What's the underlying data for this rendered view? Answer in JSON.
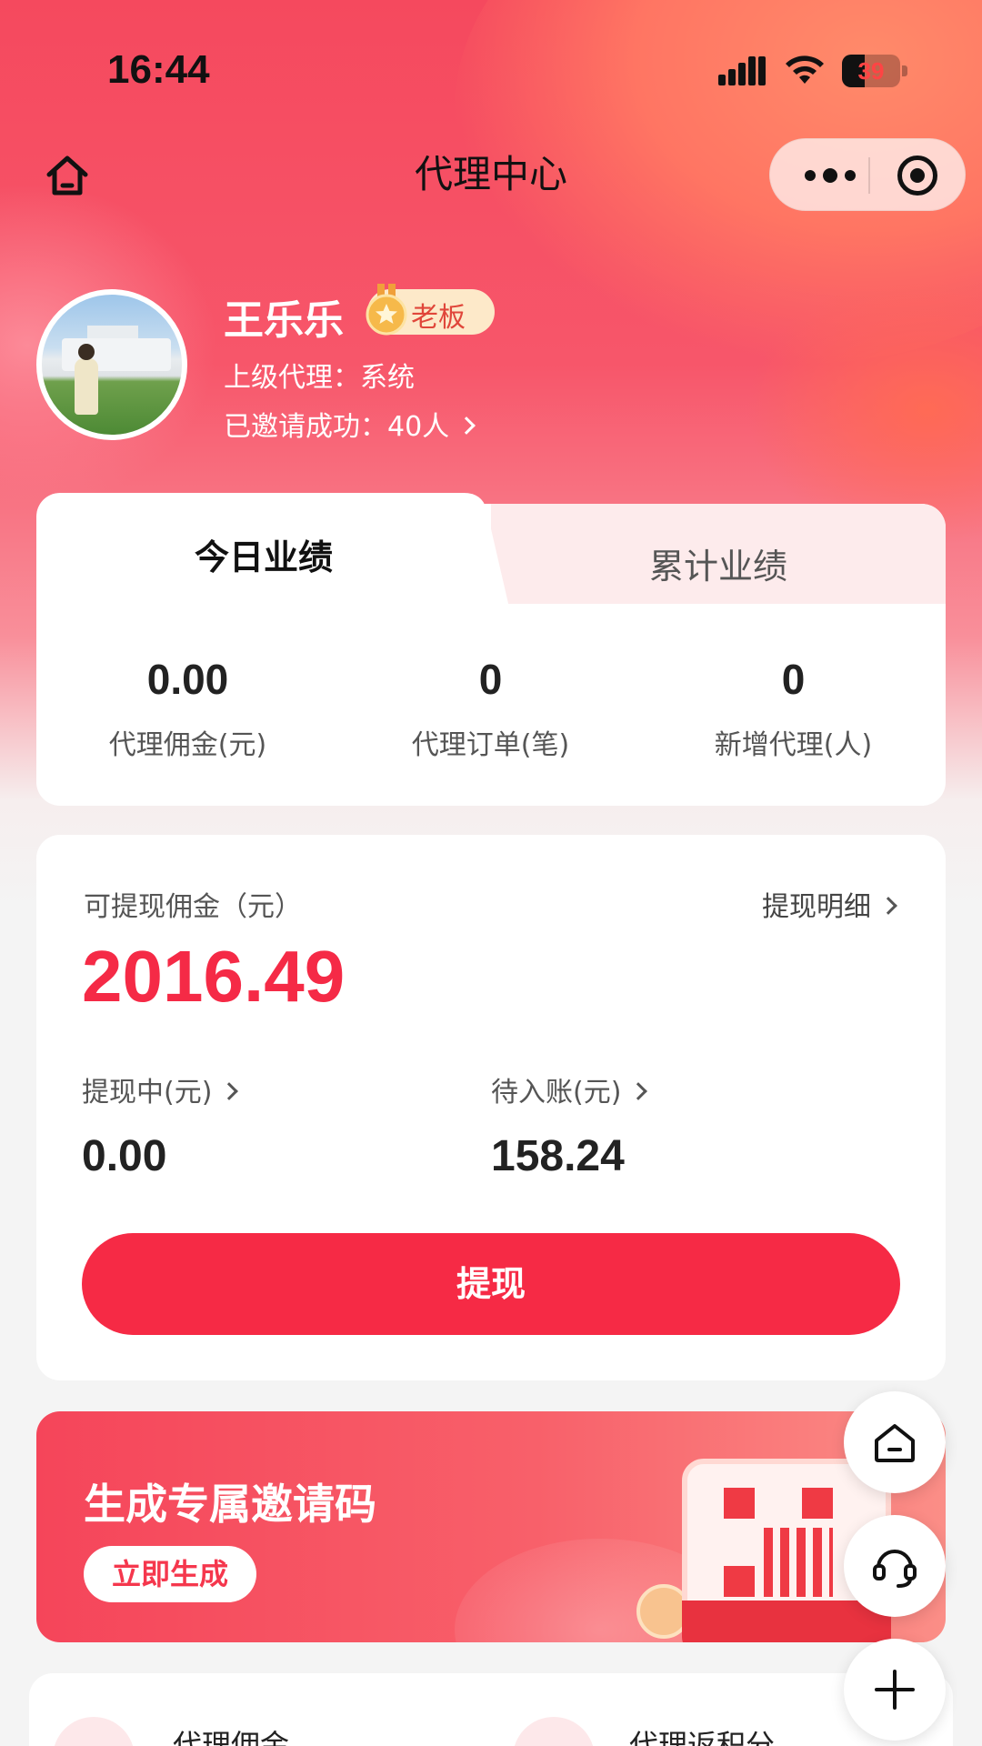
{
  "status_bar": {
    "time": "16:44",
    "battery": "39",
    "battery_level": 0.39
  },
  "nav": {
    "title": "代理中心"
  },
  "profile": {
    "name": "王乐乐",
    "badge": "老板",
    "superior": "上级代理：系统",
    "invited": "已邀请成功：40人"
  },
  "performance": {
    "tabs": [
      "今日业绩",
      "累计业绩"
    ],
    "stats": [
      {
        "value": "0.00",
        "label": "代理佣金(元)"
      },
      {
        "value": "0",
        "label": "代理订单(笔)"
      },
      {
        "value": "0",
        "label": "新增代理(人)"
      }
    ]
  },
  "commission": {
    "label": "可提现佣金（元）",
    "detail_link": "提现明细",
    "value": "2016.49",
    "withdrawing_label": "提现中(元)",
    "withdrawing_value": "0.00",
    "pending_label": "待入账(元)",
    "pending_value": "158.24",
    "withdraw_button": "提现"
  },
  "invite_banner": {
    "title": "生成专属邀请码",
    "button": "立即生成"
  },
  "bottom_items": [
    "代理佣金",
    "代理返积分"
  ],
  "colors": {
    "accent": "#f62a45",
    "badge_bg": "#fde9c9"
  }
}
